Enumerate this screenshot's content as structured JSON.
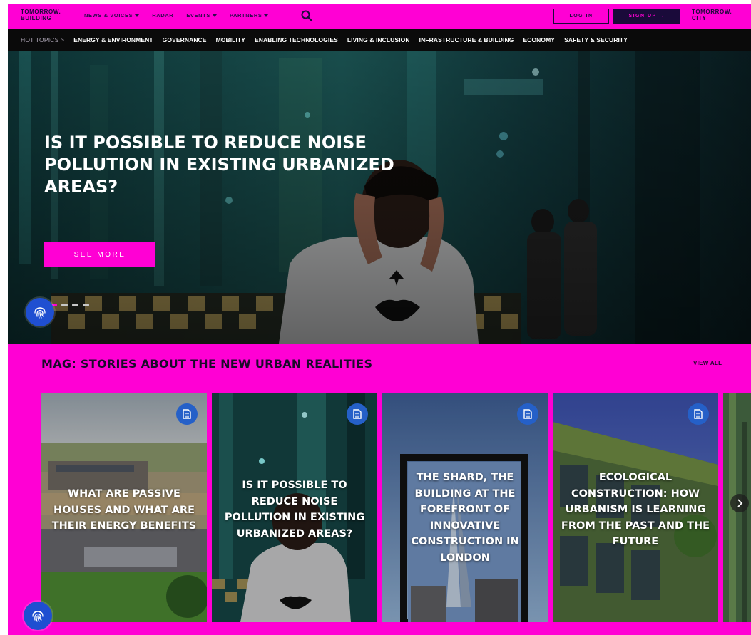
{
  "header": {
    "logo_line1": "TOMORROW.",
    "logo_line2": "BUILDING",
    "nav": [
      {
        "label": "NEWS & VOICES",
        "dropdown": true
      },
      {
        "label": "RADAR",
        "dropdown": false
      },
      {
        "label": "EVENTS",
        "dropdown": true
      },
      {
        "label": "PARTNERS",
        "dropdown": true
      }
    ],
    "search_icon": "search-icon",
    "login_label": "LOG IN",
    "signup_label": "SIGN UP →",
    "city_line1": "TOMORROW.",
    "city_line2": "CITY"
  },
  "hot_topics": {
    "label": "HOT TOPICS >",
    "items": [
      "ENERGY & ENVIRONMENT",
      "GOVERNANCE",
      "MOBILITY",
      "ENABLING TECHNOLOGIES",
      "LIVING & INCLUSION",
      "INFRASTRUCTURE & BUILDING",
      "ECONOMY",
      "SAFETY & SECURITY"
    ]
  },
  "hero": {
    "title": "IS IT POSSIBLE TO REDUCE NOISE POLLUTION IN EXISTING URBANIZED AREAS?",
    "cta_label": "SEE MORE",
    "slides": 4,
    "active_slide": 1,
    "fingerprint_icon": "fingerprint-icon"
  },
  "mag": {
    "title": "MAG: STORIES ABOUT THE NEW URBAN REALITIES",
    "view_all_label": "VIEW ALL",
    "cards": [
      {
        "title": "WHAT ARE PASSIVE HOUSES AND WHAT ARE THEIR ENERGY BENEFITS",
        "icon": "document-icon"
      },
      {
        "title": "IS IT POSSIBLE TO REDUCE NOISE POLLUTION IN EXISTING URBANIZED AREAS?",
        "icon": "document-icon"
      },
      {
        "title": "THE SHARD, THE BUILDING AT THE FOREFRONT OF INNOVATIVE CONSTRUCTION IN LONDON",
        "icon": "document-icon"
      },
      {
        "title": "ECOLOGICAL CONSTRUCTION: HOW URBANISM IS LEARNING FROM THE PAST AND THE FUTURE",
        "icon": "document-icon"
      }
    ],
    "next_icon": "chevron-right-icon"
  },
  "colors": {
    "brand_magenta": "#ff00d4",
    "dark": "#1a0a3a",
    "badge_blue": "#2560c8"
  }
}
